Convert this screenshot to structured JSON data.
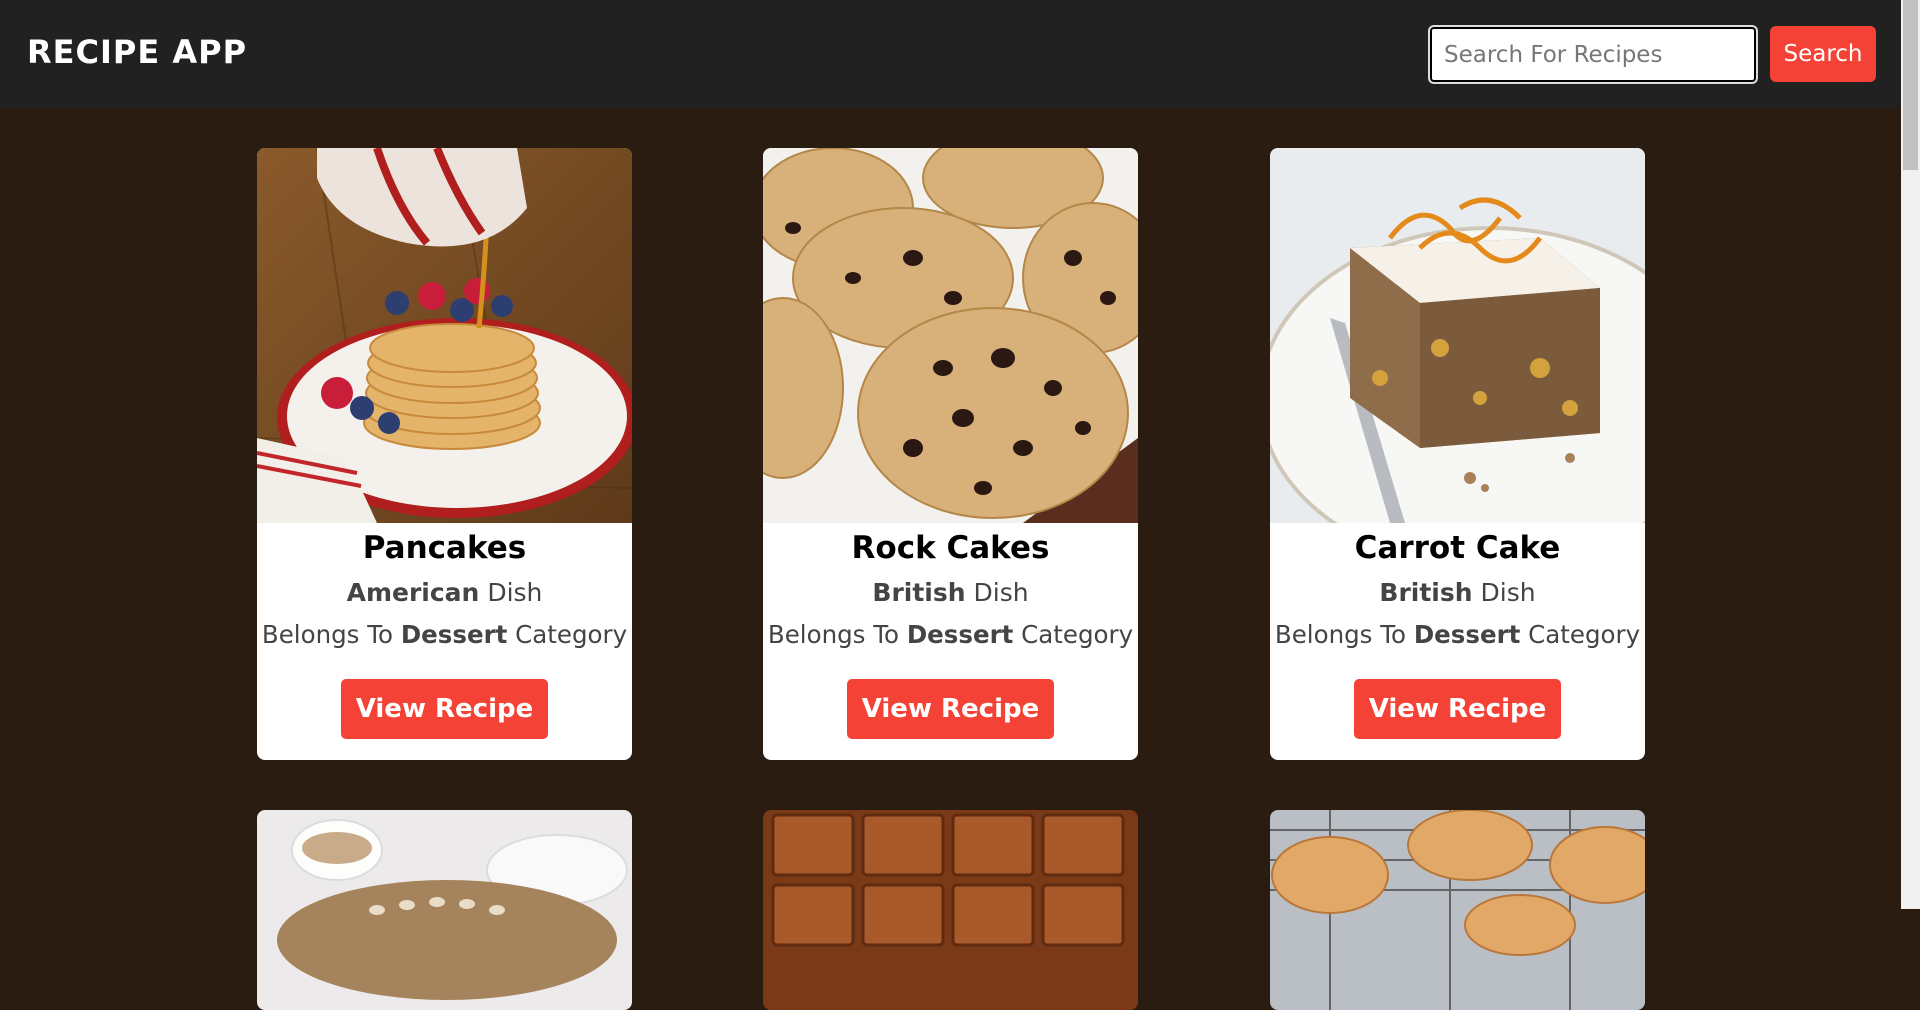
{
  "header": {
    "title": "RECIPE APP",
    "search_placeholder": "Search For Recipes",
    "search_value": "",
    "search_label": "Search"
  },
  "colors": {
    "header_bg": "#212121",
    "page_bg": "#2a1c11",
    "accent": "#f44336",
    "card_bg": "#ffffff"
  },
  "recipes": [
    {
      "name": "Pancakes",
      "area": "American",
      "area_suffix": "Dish",
      "category_prefix": "Belongs To",
      "category": "Dessert",
      "category_suffix": "Category",
      "button_label": "View Recipe"
    },
    {
      "name": "Rock Cakes",
      "area": "British",
      "area_suffix": "Dish",
      "category_prefix": "Belongs To",
      "category": "Dessert",
      "category_suffix": "Category",
      "button_label": "View Recipe"
    },
    {
      "name": "Carrot Cake",
      "area": "British",
      "area_suffix": "Dish",
      "category_prefix": "Belongs To",
      "category": "Dessert",
      "category_suffix": "Category",
      "button_label": "View Recipe"
    }
  ]
}
